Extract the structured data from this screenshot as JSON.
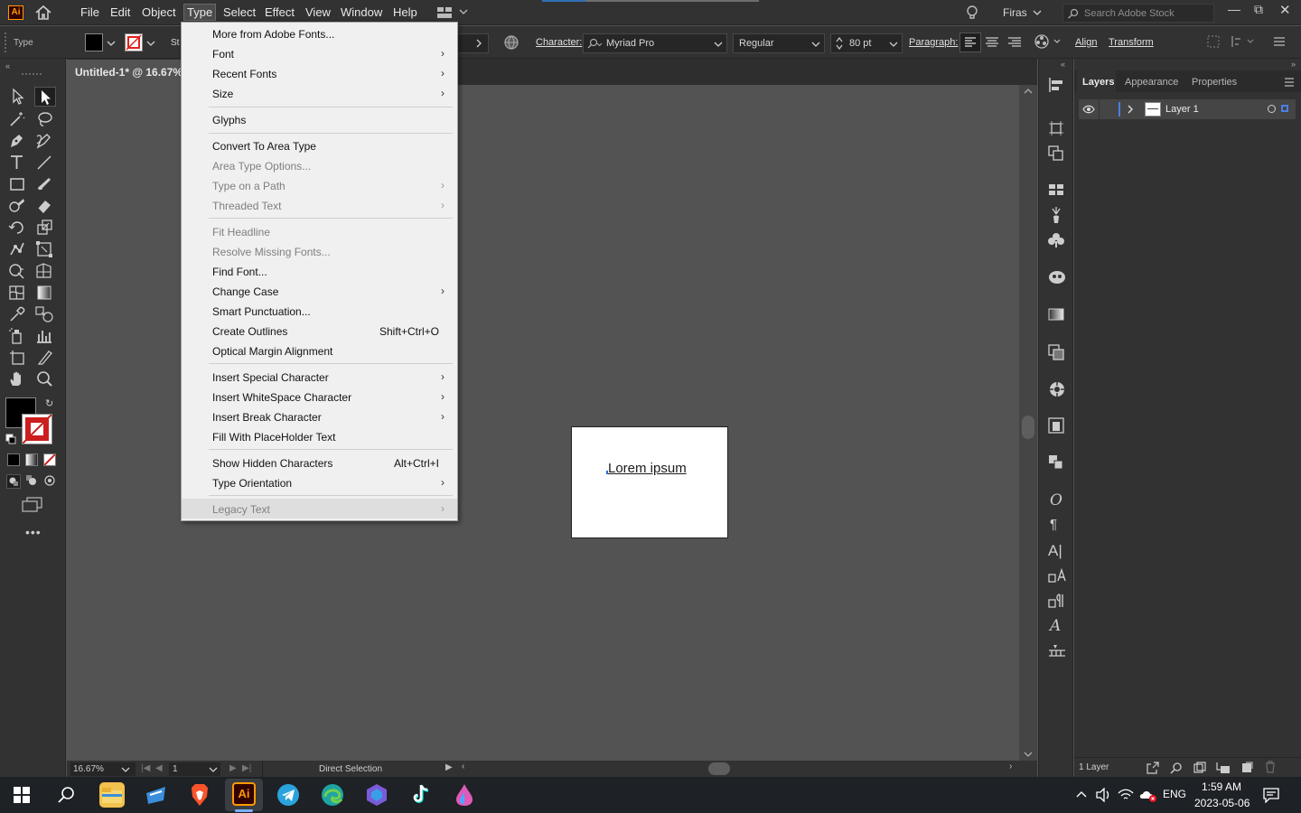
{
  "app": {
    "logo": "Ai",
    "user": "Firas",
    "search_placeholder": "Search Adobe Stock"
  },
  "menubar": [
    "File",
    "Edit",
    "Object",
    "Type",
    "Select",
    "Effect",
    "View",
    "Window",
    "Help"
  ],
  "control": {
    "mode": "Type",
    "stroke_prefix": "St",
    "character_label": "Character:",
    "font_family": "Myriad Pro",
    "font_style": "Regular",
    "font_size": "80 pt",
    "paragraph_label": "Paragraph:",
    "align_label": "Align",
    "transform_label": "Transform"
  },
  "document": {
    "tab_title": "Untitled-1* @ 16.67%",
    "artboard_text": "Lorem ipsum"
  },
  "status": {
    "zoom": "16.67%",
    "artboard": "1",
    "tool": "Direct Selection"
  },
  "panels": {
    "tabs": [
      "Layers",
      "Appearance",
      "Properties"
    ],
    "layer_name": "Layer 1",
    "count": "1 Layer"
  },
  "type_menu": [
    {
      "label": "More from Adobe Fonts...",
      "disabled": false,
      "arrow": false
    },
    {
      "label": "Font",
      "disabled": false,
      "arrow": true
    },
    {
      "label": "Recent Fonts",
      "disabled": false,
      "arrow": true
    },
    {
      "label": "Size",
      "disabled": false,
      "arrow": true
    },
    {
      "label": "Glyphs",
      "disabled": false,
      "arrow": false
    },
    {
      "label": "Convert To Area Type",
      "disabled": false,
      "arrow": false
    },
    {
      "label": "Area Type Options...",
      "disabled": true,
      "arrow": false
    },
    {
      "label": "Type on a Path",
      "disabled": true,
      "arrow": true
    },
    {
      "label": "Threaded Text",
      "disabled": true,
      "arrow": true
    },
    {
      "label": "Fit Headline",
      "disabled": true,
      "arrow": false
    },
    {
      "label": "Resolve Missing Fonts...",
      "disabled": true,
      "arrow": false
    },
    {
      "label": "Find Font...",
      "disabled": false,
      "arrow": false
    },
    {
      "label": "Change Case",
      "disabled": false,
      "arrow": true
    },
    {
      "label": "Smart Punctuation...",
      "disabled": false,
      "arrow": false
    },
    {
      "label": "Create Outlines",
      "disabled": false,
      "arrow": false,
      "shortcut": "Shift+Ctrl+O"
    },
    {
      "label": "Optical Margin Alignment",
      "disabled": false,
      "arrow": false
    },
    {
      "label": "Insert Special Character",
      "disabled": false,
      "arrow": true
    },
    {
      "label": "Insert WhiteSpace Character",
      "disabled": false,
      "arrow": true
    },
    {
      "label": "Insert Break Character",
      "disabled": false,
      "arrow": true
    },
    {
      "label": "Fill With PlaceHolder Text",
      "disabled": false,
      "arrow": false
    },
    {
      "label": "Show Hidden Characters",
      "disabled": false,
      "arrow": false,
      "shortcut": "Alt+Ctrl+I"
    },
    {
      "label": "Type Orientation",
      "disabled": false,
      "arrow": true
    },
    {
      "label": "Legacy Text",
      "disabled": true,
      "arrow": true,
      "highlighted": true
    }
  ],
  "taskbar": {
    "language": "ENG",
    "time": "1:59 AM",
    "date": "2023-05-06"
  }
}
